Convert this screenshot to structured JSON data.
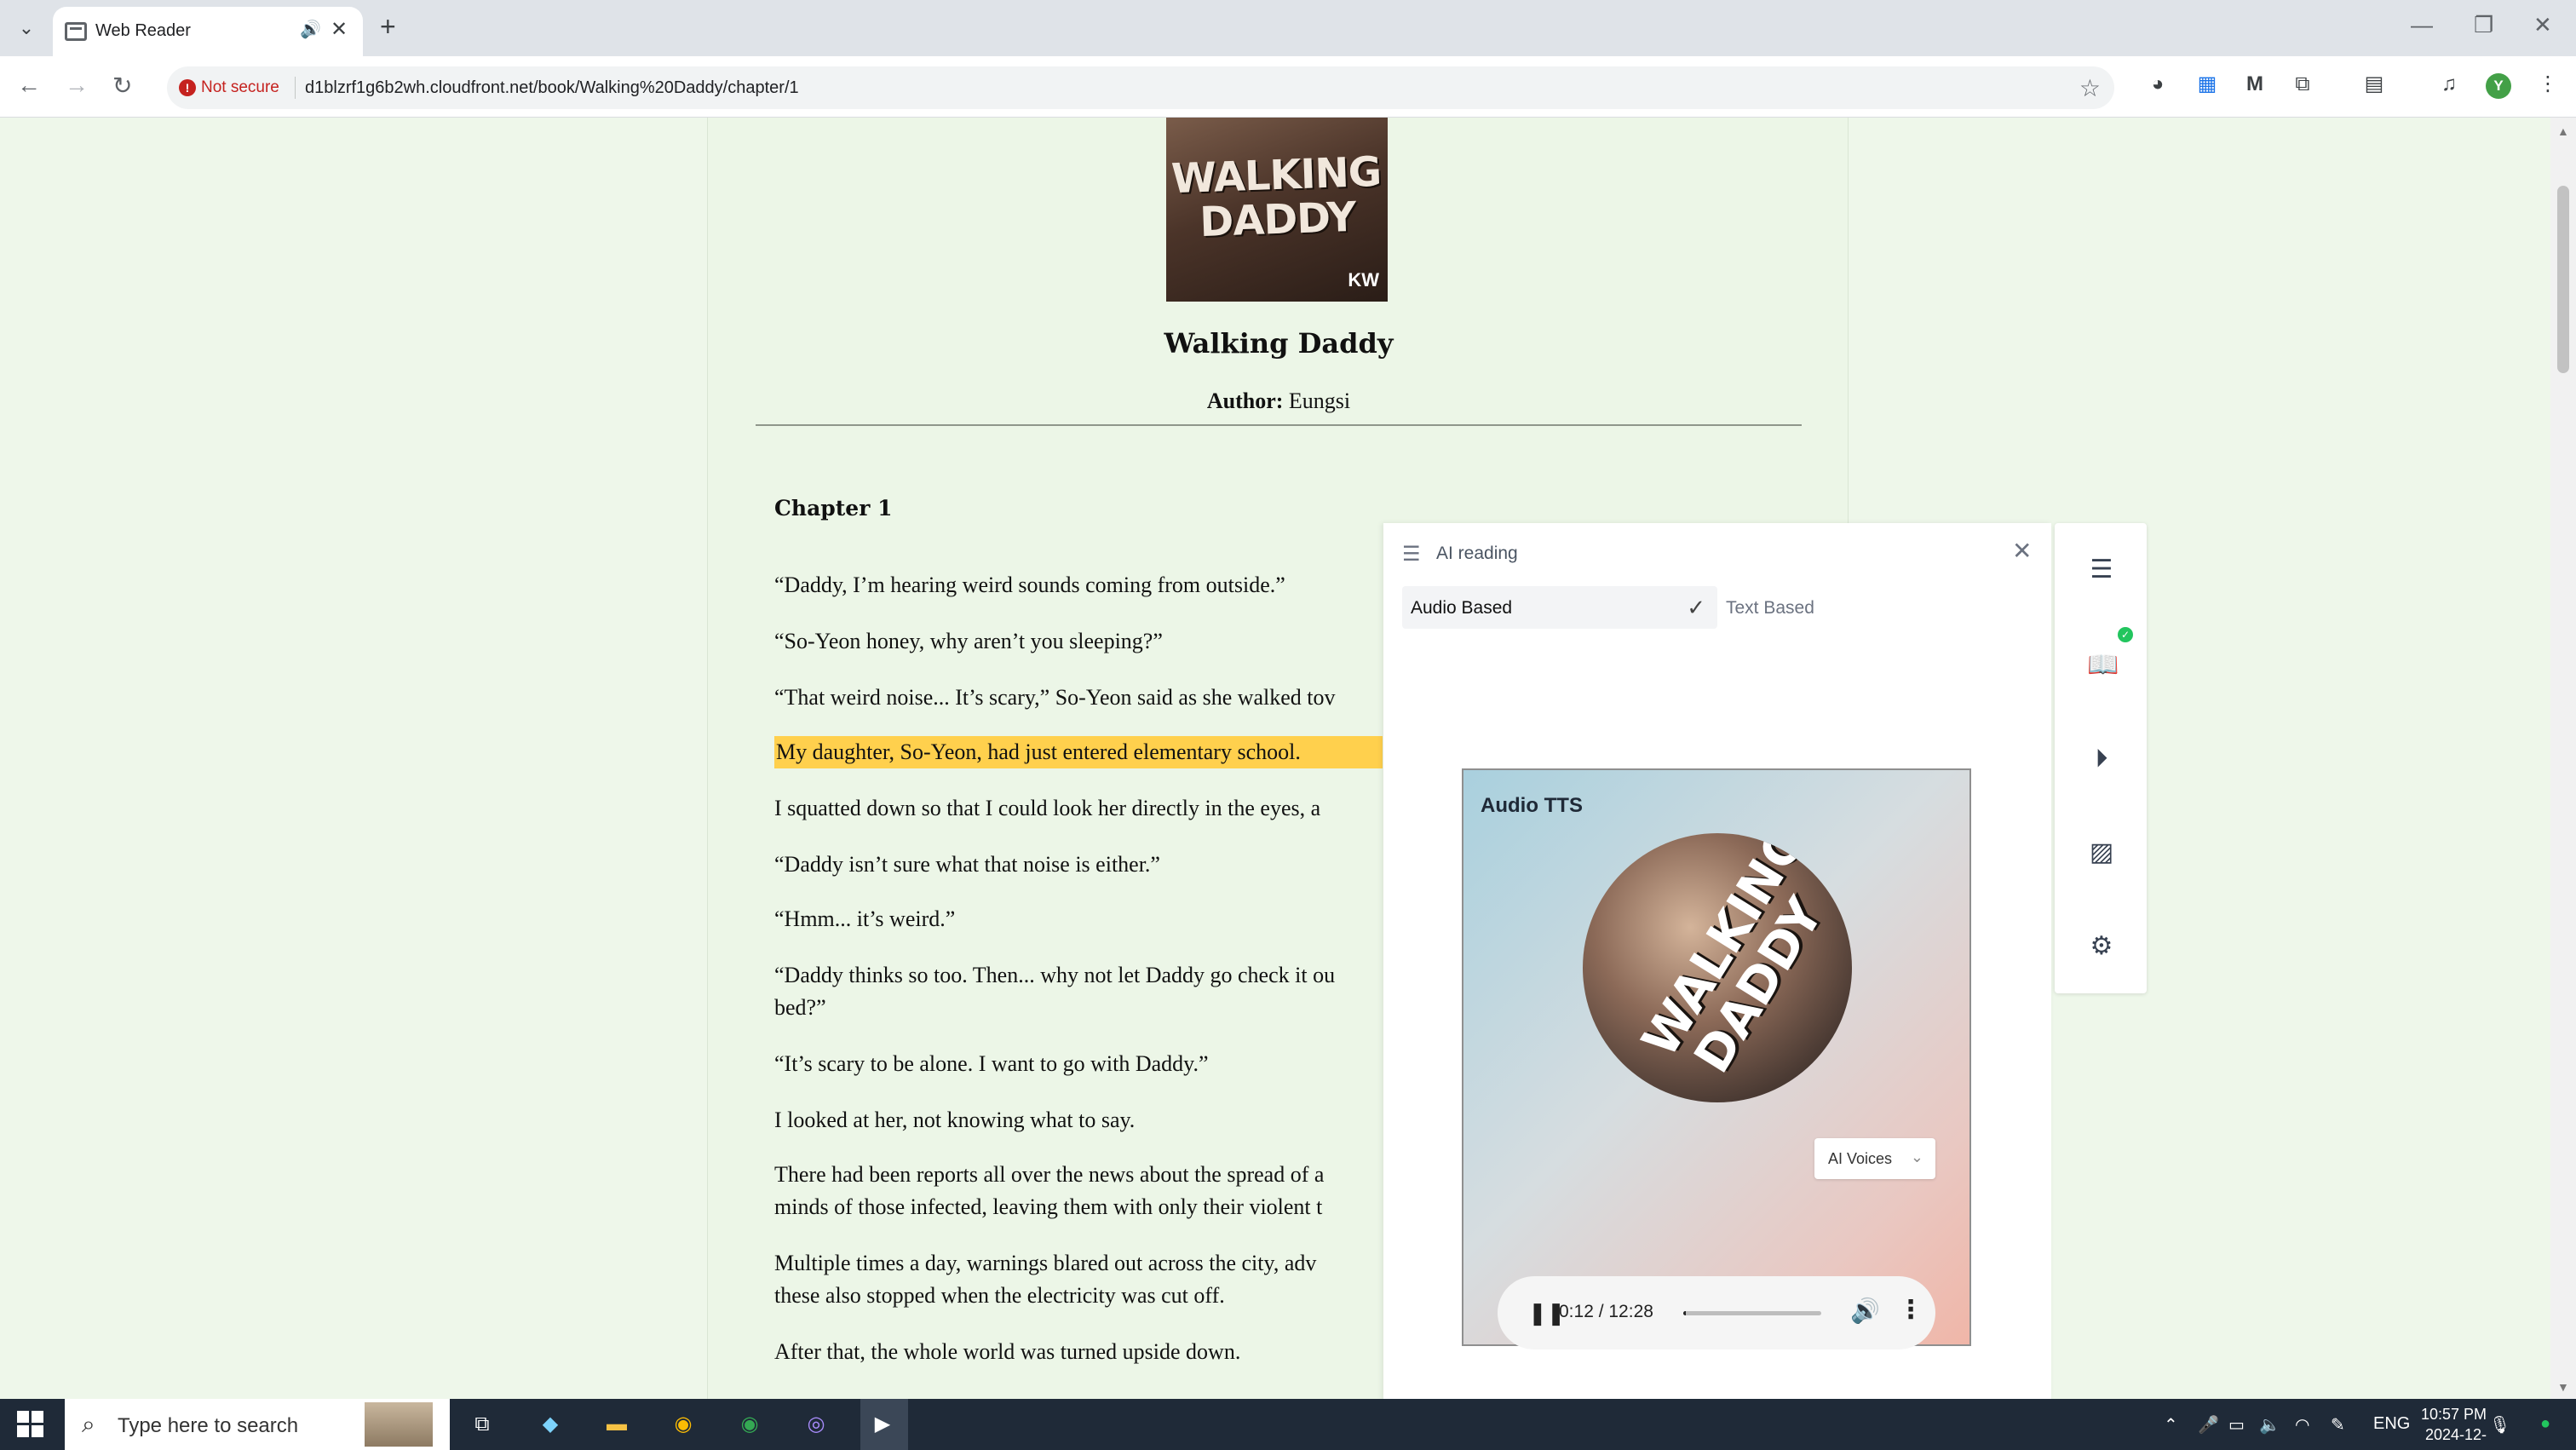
{
  "browser": {
    "tab_title": "Web Reader",
    "security_label": "Not secure",
    "url": "d1blzrf1g6b2wh.cloudfront.net/book/Walking%20Daddy/chapter/1",
    "profile_initial": "Y"
  },
  "book": {
    "cover_title": "WALKING DADDY",
    "cover_mark": "KW",
    "title": "Walking Daddy",
    "author_label": "Author:",
    "author": "Eungsi",
    "chapter_title": "Chapter 1",
    "paragraphs": [
      "“Daddy, I’m hearing weird sounds coming from outside.”",
      "“So-Yeon honey, why aren’t you sleeping?”",
      "“That weird noise... It’s scary,” So-Yeon said as she walked tov",
      "My daughter, So-Yeon, had just entered elementary school.",
      "I squatted down so that I could look her directly in the eyes, a",
      "“Daddy isn’t sure what that noise is either.”",
      "“Hmm... it’s weird.”",
      "“Daddy thinks so too. Then... why not let Daddy go check it ou",
      "bed?”",
      "“It’s scary to be alone. I want to go with Daddy.”",
      "I looked at her, not knowing what to say.",
      "There had been reports all over the news about the spread of a",
      "minds of those infected, leaving them with only their violent t",
      "Multiple times a day, warnings blared out across the city, adv",
      "these also stopped when the electricity was cut off.",
      "After that, the whole world was turned upside down."
    ],
    "highlighted_paragraph_index": 3
  },
  "ai_panel": {
    "title": "AI reading",
    "mode_audio": "Audio Based",
    "mode_text": "Text Based",
    "card_label": "Audio TTS",
    "disc_title": "WALKING DADDY",
    "voices_label": "AI Voices",
    "player": {
      "time": "0:12 / 12:28",
      "progress_fraction": 0.016
    }
  },
  "taskbar": {
    "search_placeholder": "Type here to search",
    "lang": "ENG",
    "time": "10:57 PM",
    "date": "2024-12-"
  },
  "icons": {
    "rail": [
      "list-icon",
      "book-icon",
      "play-circle-icon",
      "image-icon",
      "settings-icon"
    ]
  }
}
